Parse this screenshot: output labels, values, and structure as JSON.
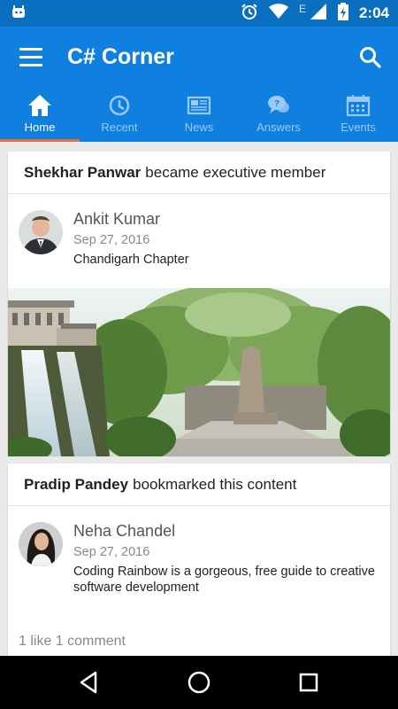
{
  "status": {
    "time": "2:04",
    "network_letter": "E"
  },
  "appbar": {
    "title": "C# Corner"
  },
  "tabs": [
    {
      "label": "Home",
      "icon": "home-icon",
      "active": true
    },
    {
      "label": "Recent",
      "icon": "clock-icon",
      "active": false
    },
    {
      "label": "News",
      "icon": "newspaper-icon",
      "active": false
    },
    {
      "label": "Answers",
      "icon": "chat-bubbles-icon",
      "active": false
    },
    {
      "label": "Events",
      "icon": "calendar-icon",
      "active": false
    }
  ],
  "feed": [
    {
      "actor": "Shekhar Panwar",
      "action": "became executive member",
      "author": "Ankit Kumar",
      "date": "Sep 27, 2016",
      "description": "Chandigarh Chapter",
      "has_image": true
    },
    {
      "actor": "Pradip Pandey",
      "action": "bookmarked this content",
      "author": "Neha Chandel",
      "date": "Sep 27, 2016",
      "description": "Coding Rainbow is a gorgeous, free guide to creative software development",
      "stats": "1 like 1 comment"
    }
  ],
  "colors": {
    "appbar": "#0f80e0",
    "statusbar": "#0a6fbf",
    "tab_indicator": "#f06a3a"
  }
}
